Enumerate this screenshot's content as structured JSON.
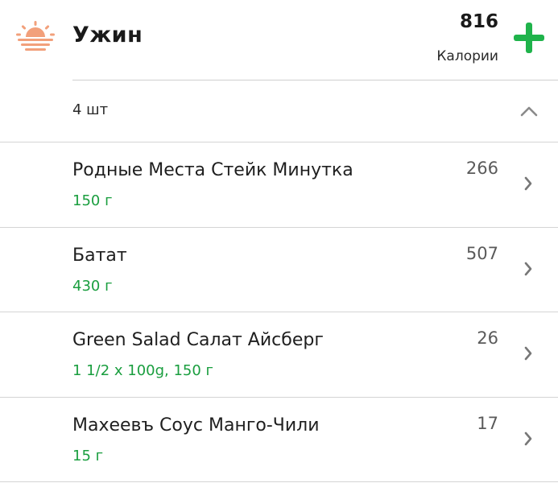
{
  "colors": {
    "accent": "#1fb34b",
    "portion": "#1a9e3f",
    "sun": "#f2a07b"
  },
  "header": {
    "icon": "sunset-icon",
    "title": "Ужин",
    "calories_total": "816",
    "calories_label": "Калории",
    "add_icon": "plus-icon"
  },
  "summary": {
    "count": "4 шт",
    "toggle_icon": "chevron-up-icon"
  },
  "items": [
    {
      "name": "Родные Места Стейк Минутка",
      "portion": "150 г",
      "calories": "266"
    },
    {
      "name": "Батат",
      "portion": "430 г",
      "calories": "507"
    },
    {
      "name": "Green Salad Салат Айсберг",
      "portion": "1 1/2 x 100g, 150 г",
      "calories": "26"
    },
    {
      "name": "Махеевъ Соус Манго-Чили",
      "portion": "15 г",
      "calories": "17"
    }
  ]
}
